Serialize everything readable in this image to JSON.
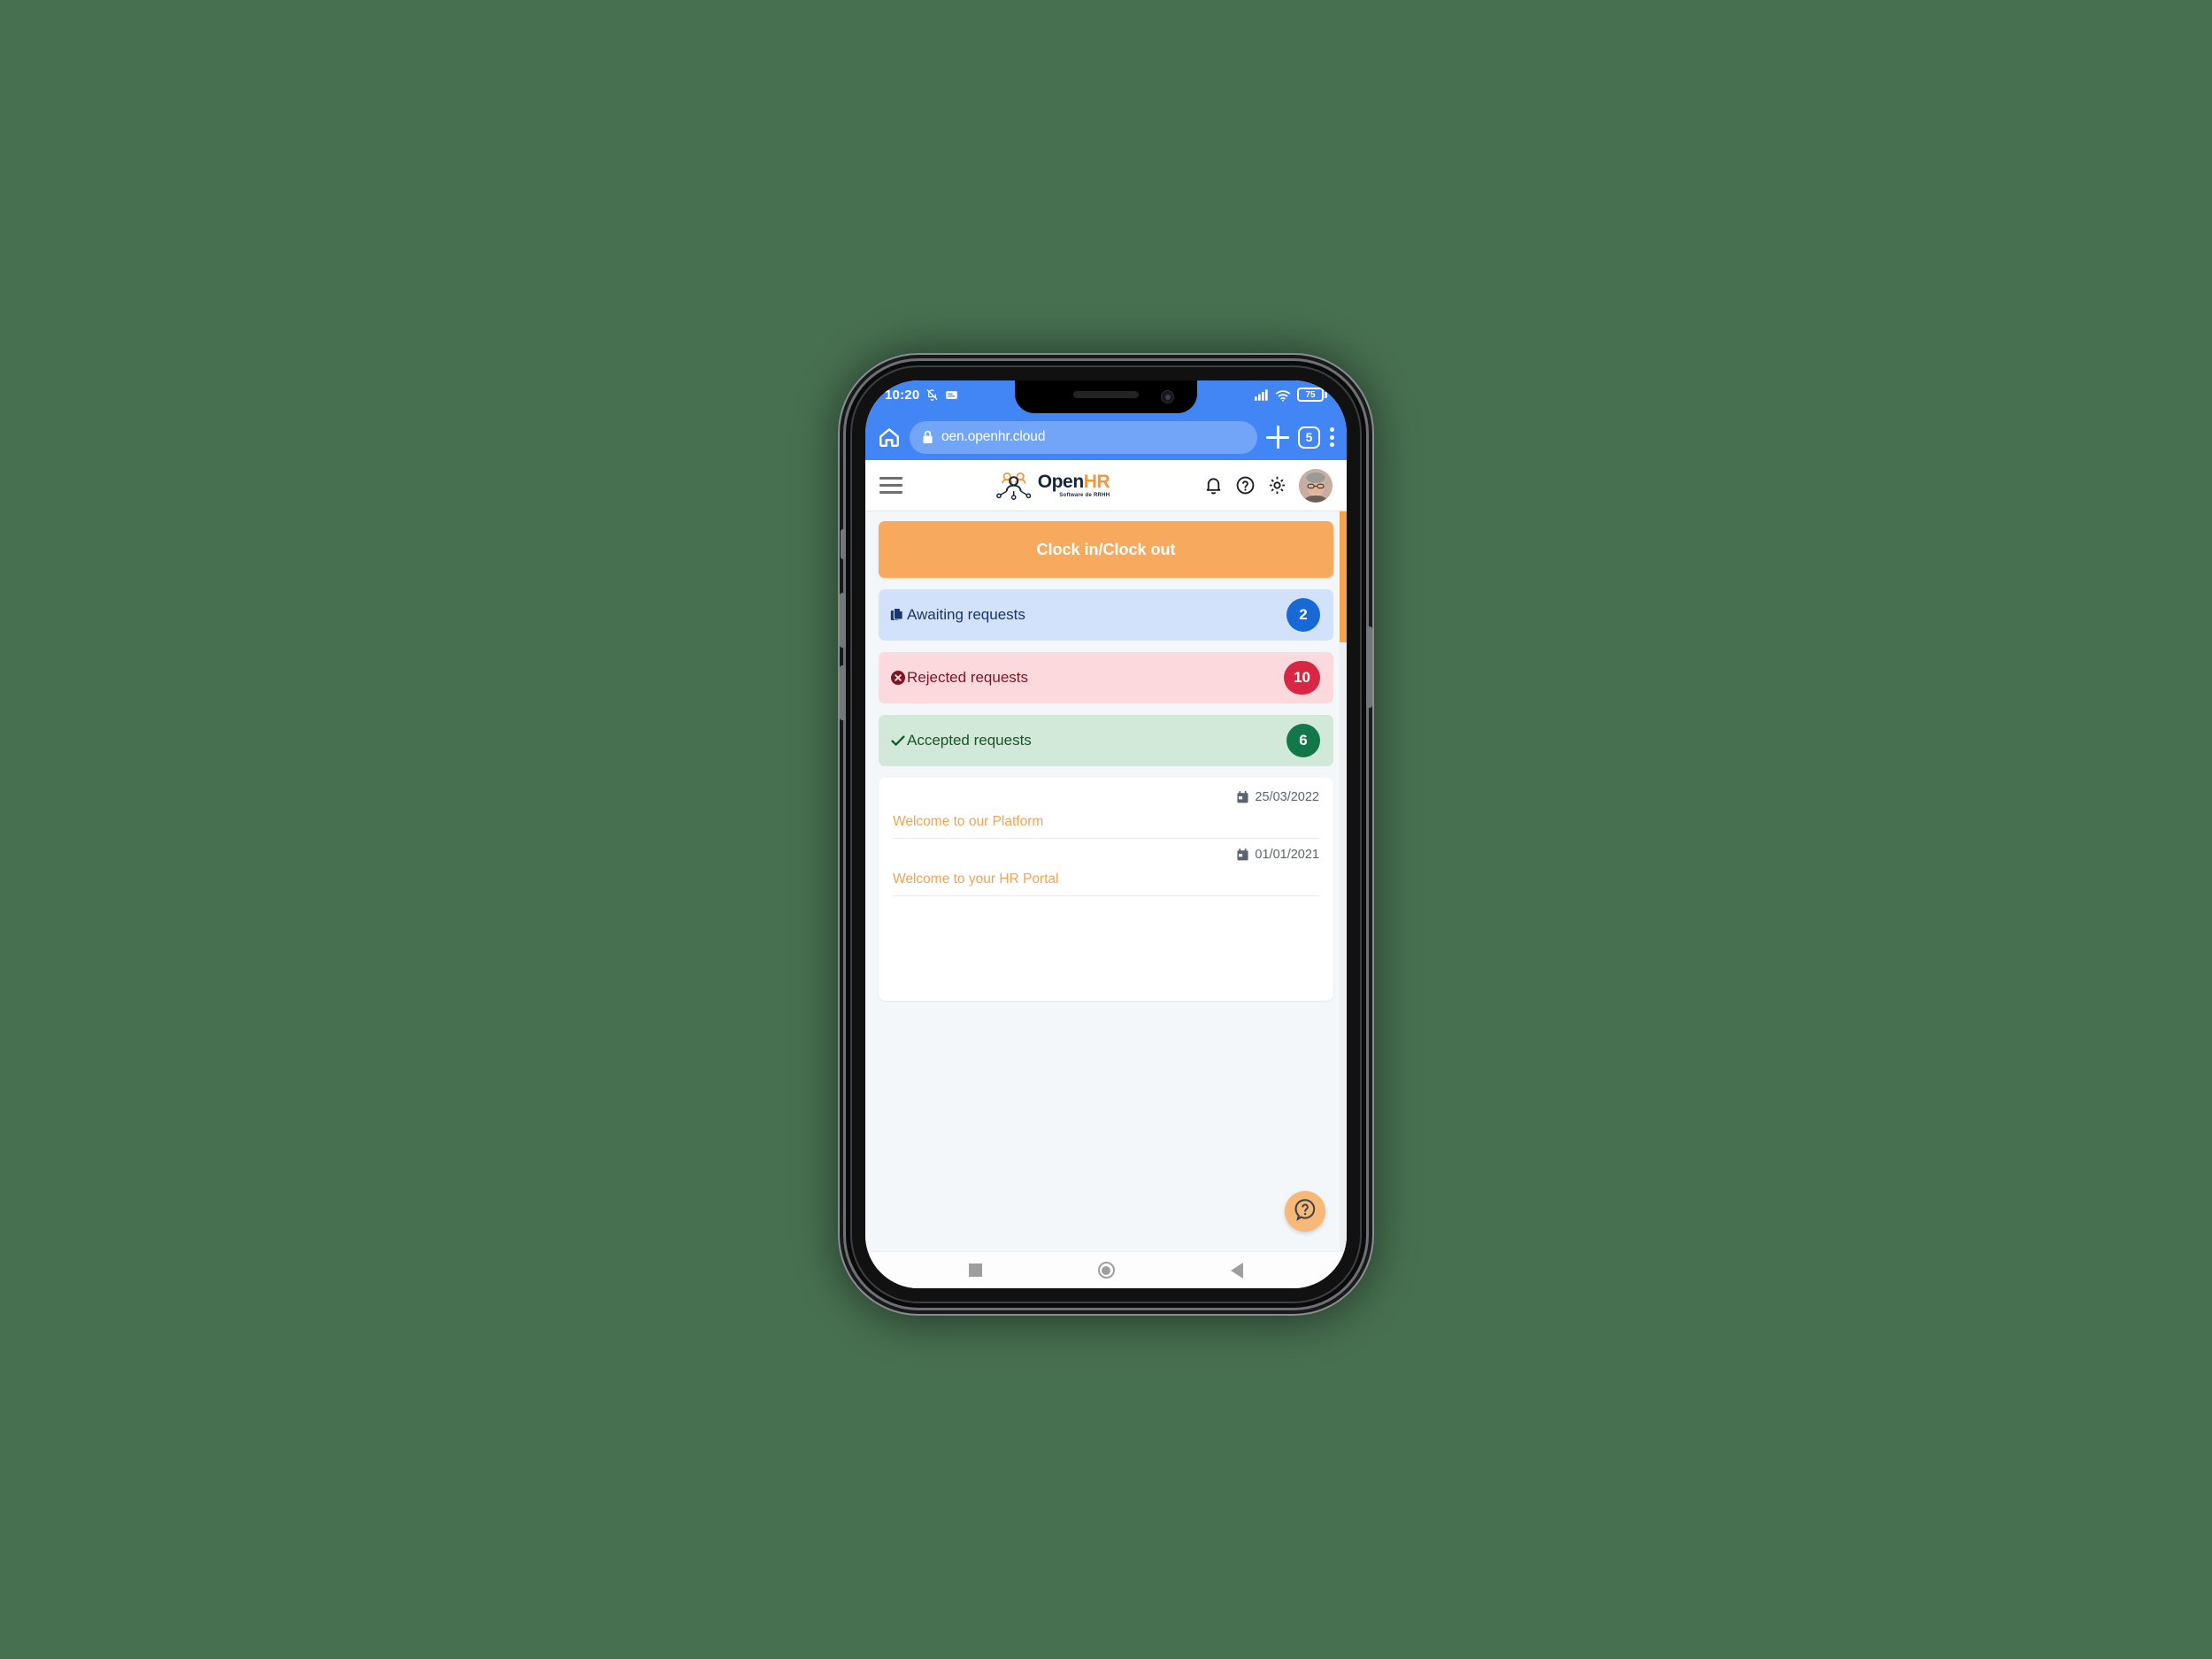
{
  "background_color": "#477050",
  "status_bar": {
    "time": "10:20",
    "bell_icon": "bell-muted-icon",
    "notification_icon": "notification-card-icon",
    "signal_icon": "cellular-signal-icon",
    "wifi_icon": "wifi-icon",
    "battery_level": "75"
  },
  "browser": {
    "home_icon": "home-icon",
    "lock_icon": "lock-icon",
    "url": "oen.openhr.cloud",
    "new_tab_icon": "plus-icon",
    "tab_count": "5",
    "menu_icon": "kebab-menu-icon"
  },
  "app_header": {
    "menu_icon": "hamburger-icon",
    "logo_primary": "Open",
    "logo_accent": "HR",
    "logo_tagline": "Software de RRHH",
    "bell_icon": "bell-icon",
    "help_icon": "help-circle-icon",
    "settings_icon": "gear-icon",
    "avatar": "user-avatar"
  },
  "main": {
    "clock_button": "Clock in/Clock out",
    "requests": [
      {
        "label": "Awaiting requests",
        "count": "2",
        "icon": "documents-copy-icon",
        "bg": "#d3e2fb",
        "badge": "#1769d6"
      },
      {
        "label": "Rejected requests",
        "count": "10",
        "icon": "circle-x-icon",
        "bg": "#fbd9dd",
        "badge": "#d92643"
      },
      {
        "label": "Accepted requests",
        "count": "6",
        "icon": "check-icon",
        "bg": "#d2e8d9",
        "badge": "#12784a"
      }
    ],
    "news": [
      {
        "date": "25/03/2022",
        "title": "Welcome to our Platform"
      },
      {
        "date": "01/01/2021",
        "title": "Welcome to your HR Portal"
      }
    ],
    "help_fab_icon": "help-bubble-icon",
    "scrollbar_color": "#f5a24f"
  },
  "android_nav": {
    "recents_icon": "square-recents-icon",
    "home_icon": "circle-home-icon",
    "back_icon": "triangle-back-icon"
  }
}
